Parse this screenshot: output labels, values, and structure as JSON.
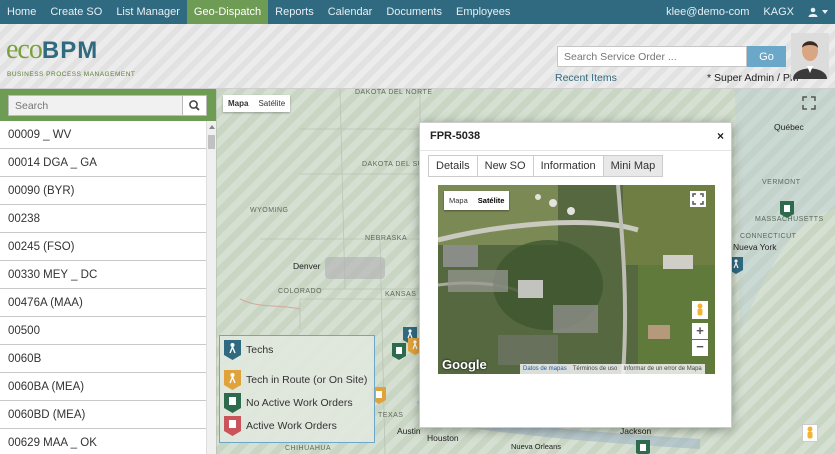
{
  "nav": {
    "items": [
      "Home",
      "Create SO",
      "List Manager",
      "Geo-Dispatch",
      "Reports",
      "Calendar",
      "Documents",
      "Employees"
    ],
    "active_index": 3,
    "user_email": "klee@demo-com",
    "org_code": "KAGX"
  },
  "header": {
    "logo_eco": "eco",
    "logo_bpm": "BPM",
    "logo_tagline": "BUSINESS PROCESS MANAGEMENT",
    "search_placeholder": "Search Service Order ...",
    "go_label": "Go",
    "recent_items": "Recent Items",
    "role": "* Super Admin / PM"
  },
  "sidebar": {
    "search_placeholder": "Search",
    "items": [
      "00009 _ WV",
      "00014 DGA _ GA",
      "00090 (BYR)",
      "00238",
      "00245 (FSO)",
      "00330 MEY _ DC",
      "00476A (MAA)",
      "00500",
      "0060B",
      "0060BA (MEA)",
      "0060BD (MEA)",
      "00629 MAA _ OK"
    ]
  },
  "map": {
    "type_toggle": {
      "map": "Mapa",
      "satellite": "Satélite"
    },
    "region_labels": [
      "DAKOTA DEL NORTE",
      "DAKOTA DEL SUR",
      "WYOMING",
      "NEBRASKA",
      "COLORADO",
      "KANSAS",
      "TEXAS",
      "CHIHUAHUA",
      "VERMONT",
      "MASSACHUSETTS",
      "CONNECTICUT"
    ],
    "city_labels": [
      "Denver",
      "Austin",
      "Houston",
      "Nueva Orleans",
      "Québec",
      "Nueva York",
      "Jackson"
    ]
  },
  "legend": {
    "items": [
      {
        "label": "Techs",
        "color": "#2f6a80"
      },
      {
        "label": "Tech in Route (or On Site)",
        "color": "#e0a33c"
      },
      {
        "label": "No Active Work Orders",
        "color": "#2e6b4e"
      },
      {
        "label": "Active Work Orders",
        "color": "#c9555a"
      }
    ]
  },
  "modal": {
    "title": "FPR-5038",
    "close": "×",
    "tabs": [
      "Details",
      "New SO",
      "Information",
      "Mini Map"
    ],
    "active_tab": 3,
    "minimap": {
      "toggle_map": "Mapa",
      "toggle_satellite": "Satélite",
      "google": "Google",
      "footer": [
        "Datos de mapas",
        "Términos de uso",
        "Informar de un error de Mapa"
      ],
      "zoom_in": "+",
      "zoom_out": "−"
    }
  }
}
